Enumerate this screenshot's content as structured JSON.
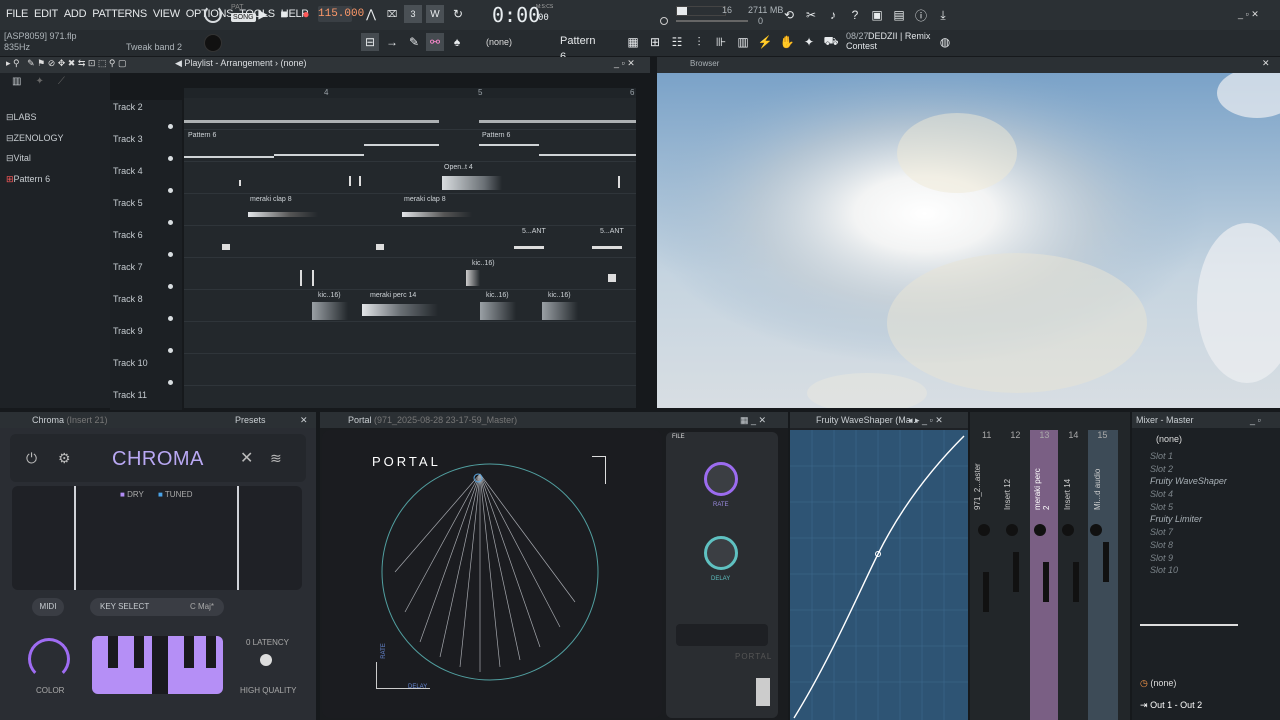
{
  "menu": [
    "FILE",
    "EDIT",
    "ADD",
    "PATTERNS",
    "VIEW",
    "OPTIONS",
    "TOOLS",
    "HELP"
  ],
  "transport": {
    "pat_song_top": "PAT",
    "pat_song_bottom": "SONG",
    "tempo": "115.000",
    "clock": "0:00",
    "clock_sub": "00",
    "clock_unit": "M:S:CS",
    "cpu": "16",
    "mem": "2711 MB",
    "mem_sub": "0"
  },
  "project": {
    "file": "[ASP8059] 971.flp",
    "hint": "835Hz",
    "plugin_hint": "Tweak band 2"
  },
  "toolbar": {
    "none_label": "(none)",
    "pattern": "Pattern 6",
    "news_date": "08/27",
    "news_title": "DEDZII | Remix",
    "news_sub": "Contest"
  },
  "playlist": {
    "title": "Playlist - Arrangement",
    "subtitle": "(none)"
  },
  "browser": {
    "title": "Browser"
  },
  "sidebar": [
    "LABS",
    "ZENOLOGY",
    "Vital",
    "Pattern 6"
  ],
  "ruler": [
    "4",
    "5",
    "6"
  ],
  "tracks": [
    "Track 2",
    "Track 3",
    "Track 4",
    "Track 5",
    "Track 6",
    "Track 7",
    "Track 8",
    "Track 9",
    "Track 10",
    "Track 11"
  ],
  "clips": {
    "t3a": "Pattern 6",
    "t3b": "Pattern 6",
    "t4": "Open..t 4",
    "t5a": "meraki clap 8",
    "t5b": "meraki clap 8",
    "t6a": "5...ANT",
    "t6b": "5...ANT",
    "t7": "kic..16)",
    "t8a": "kic..16)",
    "t8b": "meraki perc 14",
    "t8c": "kic..16)",
    "t8d": "kic..16)"
  },
  "chroma": {
    "header": "Chroma",
    "insert": "(Insert 21)",
    "presets": "Presets",
    "name": "CHROMA",
    "dry": "DRY",
    "tuned": "TUNED",
    "midi": "MIDI",
    "key_select": "KEY SELECT",
    "key": "C Maj*",
    "color": "COLOR",
    "latency": "0 LATENCY",
    "quality": "HIGH QUALITY"
  },
  "portal": {
    "header": "Portal",
    "file": "(971_2025-08-28 23-17-59_Master)",
    "name": "PORTAL",
    "file_tab": "FILE",
    "rate": "RATE",
    "delay": "DELAY",
    "rate_axis": "RATE",
    "delay_axis": "DELAY",
    "brand": "PORTAL"
  },
  "waveshaper": {
    "header": "Fruity WaveShaper (Ma..."
  },
  "mixer": {
    "channels": [
      "11",
      "12",
      "13",
      "14",
      "15"
    ],
    "names": [
      "971_2...aster",
      "Insert 12",
      "meraki perc 2",
      "Insert 14",
      "Mi...d audio"
    ]
  },
  "master": {
    "header": "Mixer - Master",
    "input": "(none)",
    "slots": [
      "Slot 1",
      "Slot 2",
      "Fruity WaveShaper",
      "Slot 4",
      "Slot 5",
      "Fruity Limiter",
      "Slot 7",
      "Slot 8",
      "Slot 9",
      "Slot 10"
    ],
    "output_none": "(none)",
    "output": "Out 1 - Out 2"
  },
  "colors": {
    "accent": "#8a5ad8",
    "tempo": "#ff9a6a",
    "sky": "#9ebad3",
    "ws_bg": "#2e5474"
  }
}
